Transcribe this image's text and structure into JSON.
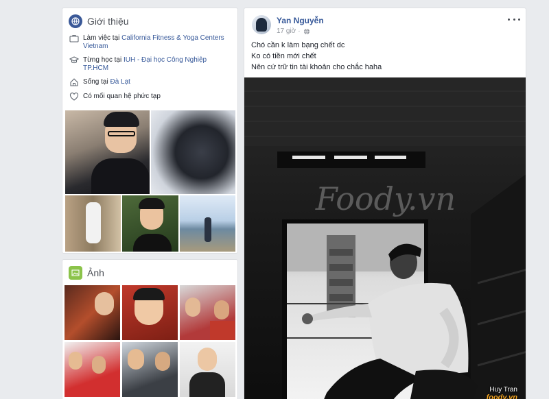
{
  "intro": {
    "title": "Giới thiệu",
    "work_prefix": "Làm việc tại",
    "work_place": "California Fitness & Yoga Centers Vietnam",
    "study_prefix": "Từng học tại",
    "study_place": "IUH - Đại học Công Nghiệp TP.HCM",
    "lives_prefix": "Sống tại",
    "lives_place": "Đà Lạt",
    "relationship": "Có mối quan hệ phức tạp"
  },
  "photos": {
    "title": "Ảnh"
  },
  "post": {
    "author": "Yan Nguyễn",
    "time": "17 giờ",
    "caption_lines": [
      "Chó cần k làm bạng chết dc",
      "Ko có tiền mới chết",
      "Nên cứ trữ tin tài khoản cho chắc haha"
    ]
  },
  "watermark": {
    "text": "Foody.vn",
    "photo_credit": "Huy Tran",
    "brand": "foody.vn"
  },
  "colors": {
    "link": "#365899",
    "page_bg": "#e9ebee",
    "intro_icon": "#3b5998",
    "photos_icon": "#8bc34a"
  },
  "icons": {
    "intro": "globe-icon",
    "work": "briefcase-icon",
    "study": "graduation-cap-icon",
    "home": "home-icon",
    "heart": "heart-icon",
    "photos": "image-icon",
    "privacy": "public-globe-icon",
    "more": "more-dots-icon"
  }
}
